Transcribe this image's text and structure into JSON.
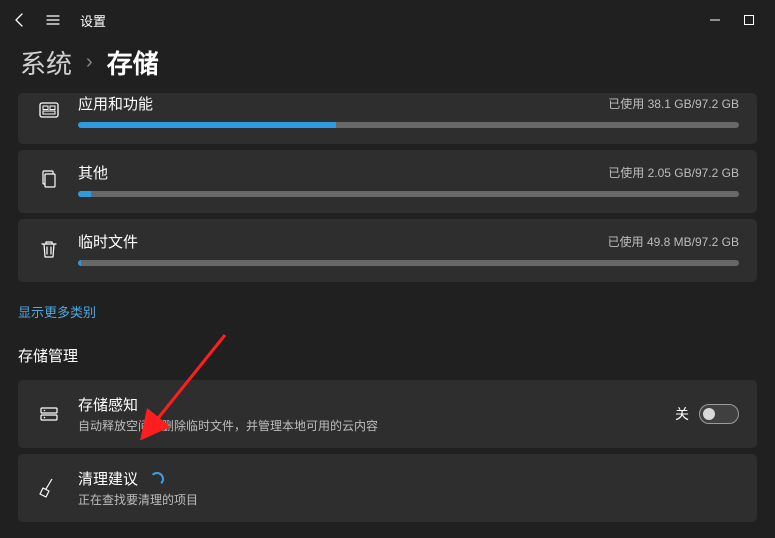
{
  "header": {
    "app_title": "设置",
    "crumb_level1": "系统",
    "crumb_sep": "›",
    "crumb_level2": "存储"
  },
  "storage": {
    "items": [
      {
        "id": "apps-features",
        "icon": "apps-icon",
        "title": "应用和功能",
        "usage": "已使用 38.1 GB/97.2 GB",
        "pct": 39
      },
      {
        "id": "other",
        "icon": "docs-icon",
        "title": "其他",
        "usage": "已使用 2.05 GB/97.2 GB",
        "pct": 2
      },
      {
        "id": "temp-files",
        "icon": "trash-icon",
        "title": "临时文件",
        "usage": "已使用 49.8 MB/97.2 GB",
        "pct": 0
      }
    ],
    "more_link": "显示更多类别"
  },
  "management": {
    "heading": "存储管理",
    "sense": {
      "title": "存储感知",
      "sub": "自动释放空间、删除临时文件，并管理本地可用的云内容",
      "toggle_label": "关"
    },
    "cleanup": {
      "title": "清理建议",
      "sub": "正在查找要清理的项目"
    }
  }
}
